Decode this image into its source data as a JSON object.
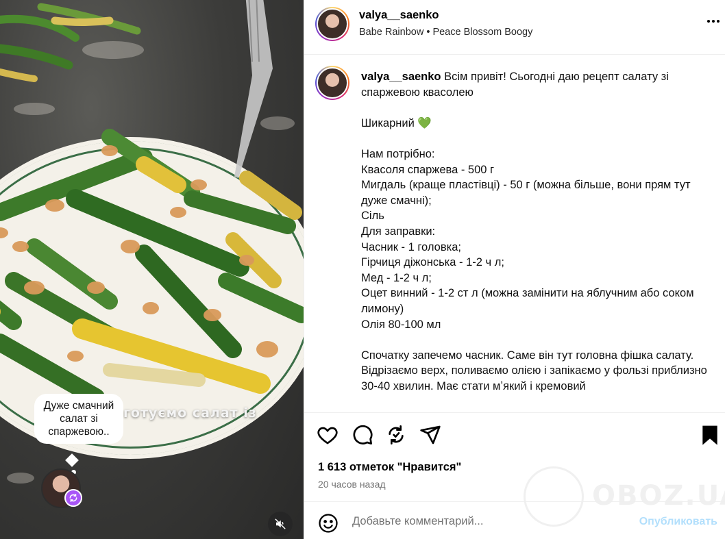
{
  "post": {
    "username": "valya__saenko",
    "audio": "Babe Rainbow • Peace Blossom Boogy",
    "more_icon": "more-horizontal-icon"
  },
  "media": {
    "overlay_text": "готуємо салат із",
    "note_bubble": "Дуже смачний салат зі спаржевою..",
    "mute_icon": "speaker-muted-icon",
    "remix_icon": "remix-icon"
  },
  "caption": {
    "username": "valya__saenko",
    "text": " Всім привіт! Сьогодні даю рецепт салату зі спаржевою квасолею\n\nШикарний ",
    "emoji": "💚",
    "body": "\n\nНам потрібно:\nКвасоля спаржева - 500 г\nМигдаль (краще пластівці) - 50 г (можна більше, вони прям тут дуже смачні);\nСіль\nДля заправки:\nЧасник - 1 головка;\nГірчиця діжонська - 1-2 ч л;\nМед - 1-2 ч л;\nОцет винний - 1-2 ст л (можна замінити на яблучним або соком лимону)\nОлія 80-100 мл\n\nСпочатку запечемо часник. Саме він тут головна фішка салату. Відрізаємо верх, поливаємо олією і запікаємо у фользі приблизно 30-40 хвилин. Має стати мʼякий і кремовий\n\nХ"
  },
  "actions": {
    "icons": [
      "heart-icon",
      "comment-icon",
      "repost-icon",
      "share-icon",
      "bookmark-icon"
    ],
    "likes": "1 613 отметок \"Нравится\"",
    "time": "20 часов назад"
  },
  "watermark": {
    "text": "OBOZ.UA"
  },
  "comment": {
    "placeholder": "Добавьте комментарий...",
    "publish_label": "Опубликовать",
    "publish_color": "#b2dffc"
  }
}
